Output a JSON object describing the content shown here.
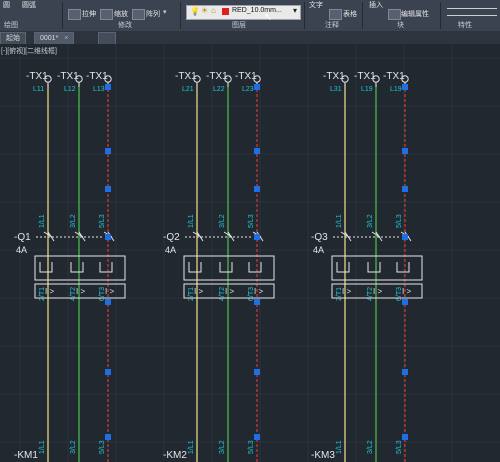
{
  "ribbon": {
    "left_labels": [
      "圆",
      "圆弧"
    ],
    "modify_tools": [
      {
        "label": "拉伸"
      },
      {
        "label": "缩放"
      },
      {
        "label": "阵列"
      }
    ],
    "layer_dropdown": {
      "value": "RED_10.0mm..."
    },
    "insert_label": "插入",
    "text_label": "文字",
    "table_label": "表格",
    "edit_attr_label": "编辑属性",
    "groups": [
      "绘图",
      "修改",
      "图层",
      "注释",
      "块",
      "特性"
    ]
  },
  "tabs": [
    {
      "label": "起始"
    },
    {
      "label": "0001*"
    }
  ],
  "viewport_label": "[-][俯视][二维线框]",
  "accent": {
    "yellow": "#f2e28a",
    "green": "#4fc24f",
    "red": "#d23b3b",
    "cyan": "#22c7d4",
    "grip": "#1e6fe6"
  },
  "groups": [
    {
      "q": "-Q1",
      "amp": "4A",
      "km": "-KM1",
      "columns": [
        {
          "tx": "-TX1",
          "l": "L11",
          "top": "1/L1",
          "bot": "2/T1"
        },
        {
          "tx": "-TX1",
          "l": "L12",
          "top": "3/L2",
          "bot": "4/T2"
        },
        {
          "tx": "-TX1",
          "l": "L13",
          "top": "5/L3",
          "bot": "6/T3"
        }
      ],
      "km_labels": [
        "1/L1",
        "3/L2",
        "5/L3"
      ]
    },
    {
      "q": "-Q2",
      "amp": "4A",
      "km": "-KM2",
      "columns": [
        {
          "tx": "-TX1",
          "l": "L21",
          "top": "1/L1",
          "bot": "2/T1"
        },
        {
          "tx": "-TX1",
          "l": "L22",
          "top": "3/L2",
          "bot": "4/T2"
        },
        {
          "tx": "-TX1",
          "l": "L23",
          "top": "5/L3",
          "bot": "6/T3"
        }
      ],
      "km_labels": [
        "1/L1",
        "3/L2",
        "5/L3"
      ]
    },
    {
      "q": "-Q3",
      "amp": "4A",
      "km": "-KM3",
      "columns": [
        {
          "tx": "-TX1",
          "l": "L31",
          "top": "1/L1",
          "bot": "2/T1"
        },
        {
          "tx": "-TX1",
          "l": "L19",
          "top": "3/L2",
          "bot": "4/T2"
        },
        {
          "tx": "-TX1",
          "l": "L19",
          "top": "5/L3",
          "bot": "6/T3"
        }
      ],
      "km_labels": [
        "1/L1",
        "3/L2",
        "5/L3"
      ]
    }
  ],
  "trip_symbol": "I >"
}
